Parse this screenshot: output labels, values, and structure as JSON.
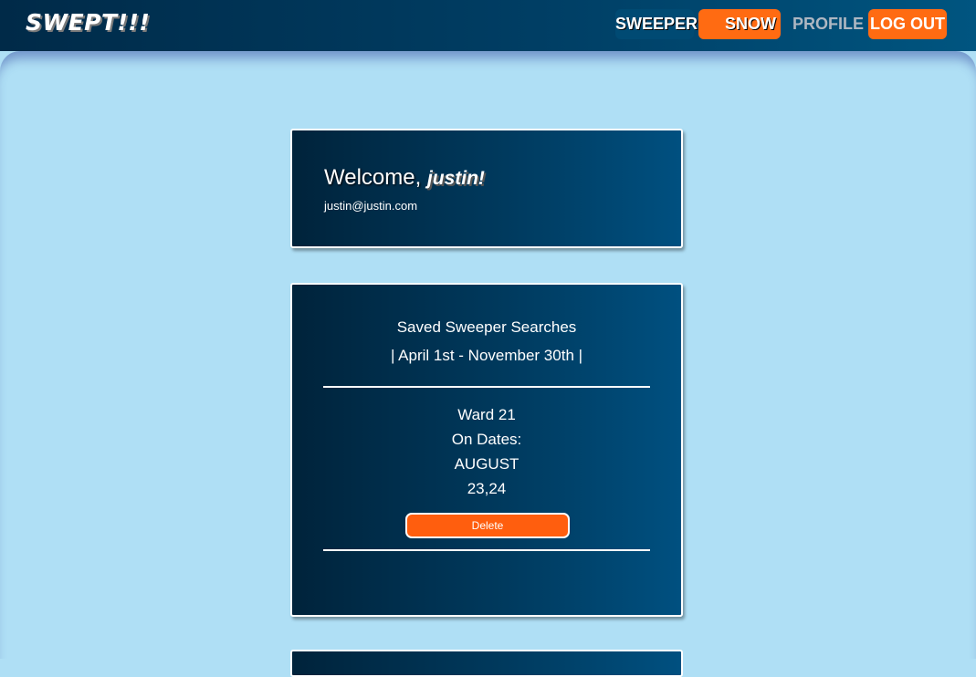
{
  "app": {
    "logo": "SWEPT!!!"
  },
  "nav": {
    "sweeper": "SWEEPER",
    "snow": "SNOW",
    "profile": "PROFILE",
    "logout": "LOG OUT"
  },
  "welcome": {
    "greeting": "Welcome,",
    "name": "justin!",
    "email": "justin@justin.com"
  },
  "searches": {
    "title": "Saved Sweeper Searches",
    "season": "| April 1st - November 30th |",
    "items": [
      {
        "ward": "Ward 21",
        "dates_label": "On Dates:",
        "month": "AUGUST",
        "days": "23,24",
        "delete_label": "Delete"
      }
    ]
  },
  "colors": {
    "accent": "#ff6b12",
    "navy": "#003a5e",
    "background": "#afdff5"
  }
}
